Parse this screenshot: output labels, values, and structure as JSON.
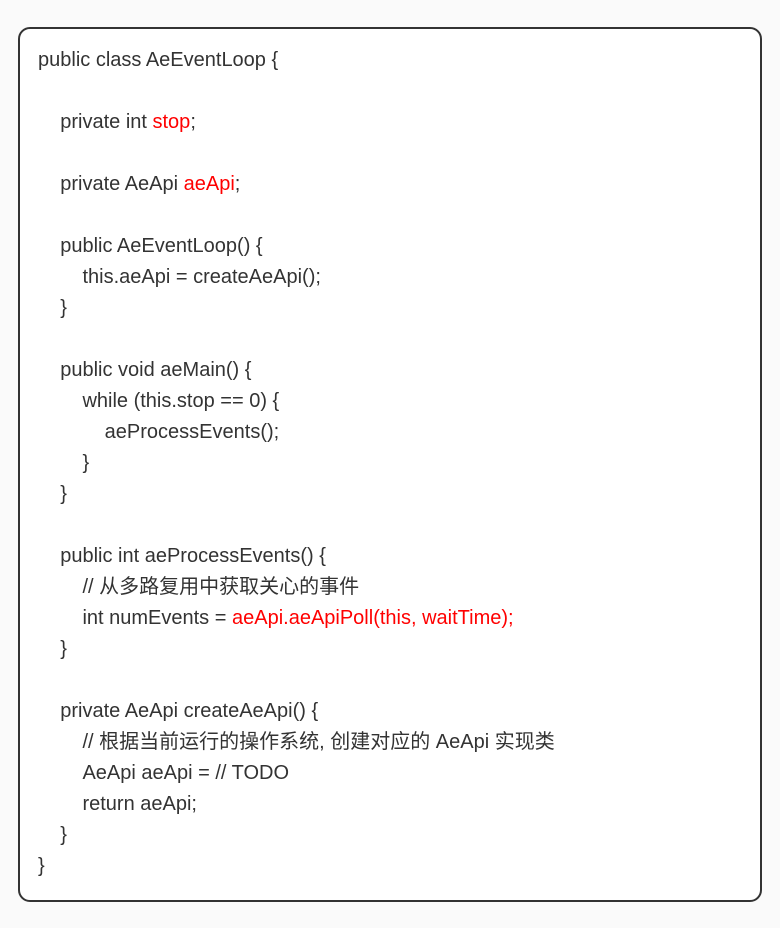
{
  "code": {
    "line1_a": "public class AeEventLoop {",
    "line2": "",
    "line3_a": "    private int ",
    "line3_b": "stop",
    "line3_c": ";",
    "line4": "",
    "line5_a": "    private AeApi ",
    "line5_b": "aeApi",
    "line5_c": ";",
    "line6": "",
    "line7": "    public AeEventLoop() {",
    "line8": "        this.aeApi = createAeApi();",
    "line9": "    }",
    "line10": "",
    "line11": "    public void aeMain() {",
    "line12": "        while (this.stop == 0) {",
    "line13": "            aeProcessEvents();",
    "line14": "        }",
    "line15": "    }",
    "line16": "",
    "line17": "    public int aeProcessEvents() {",
    "line18": "        // 从多路复用中获取关心的事件",
    "line19_a": "        int numEvents = ",
    "line19_b": "aeApi.aeApiPoll(this, waitTime);",
    "line20": "    }",
    "line21": "",
    "line22": "    private AeApi createAeApi() {",
    "line23": "        // 根据当前运行的操作系统, 创建对应的 AeApi 实现类",
    "line24": "        AeApi aeApi = // TODO",
    "line25": "        return aeApi;",
    "line26": "    }",
    "line27": "}"
  }
}
